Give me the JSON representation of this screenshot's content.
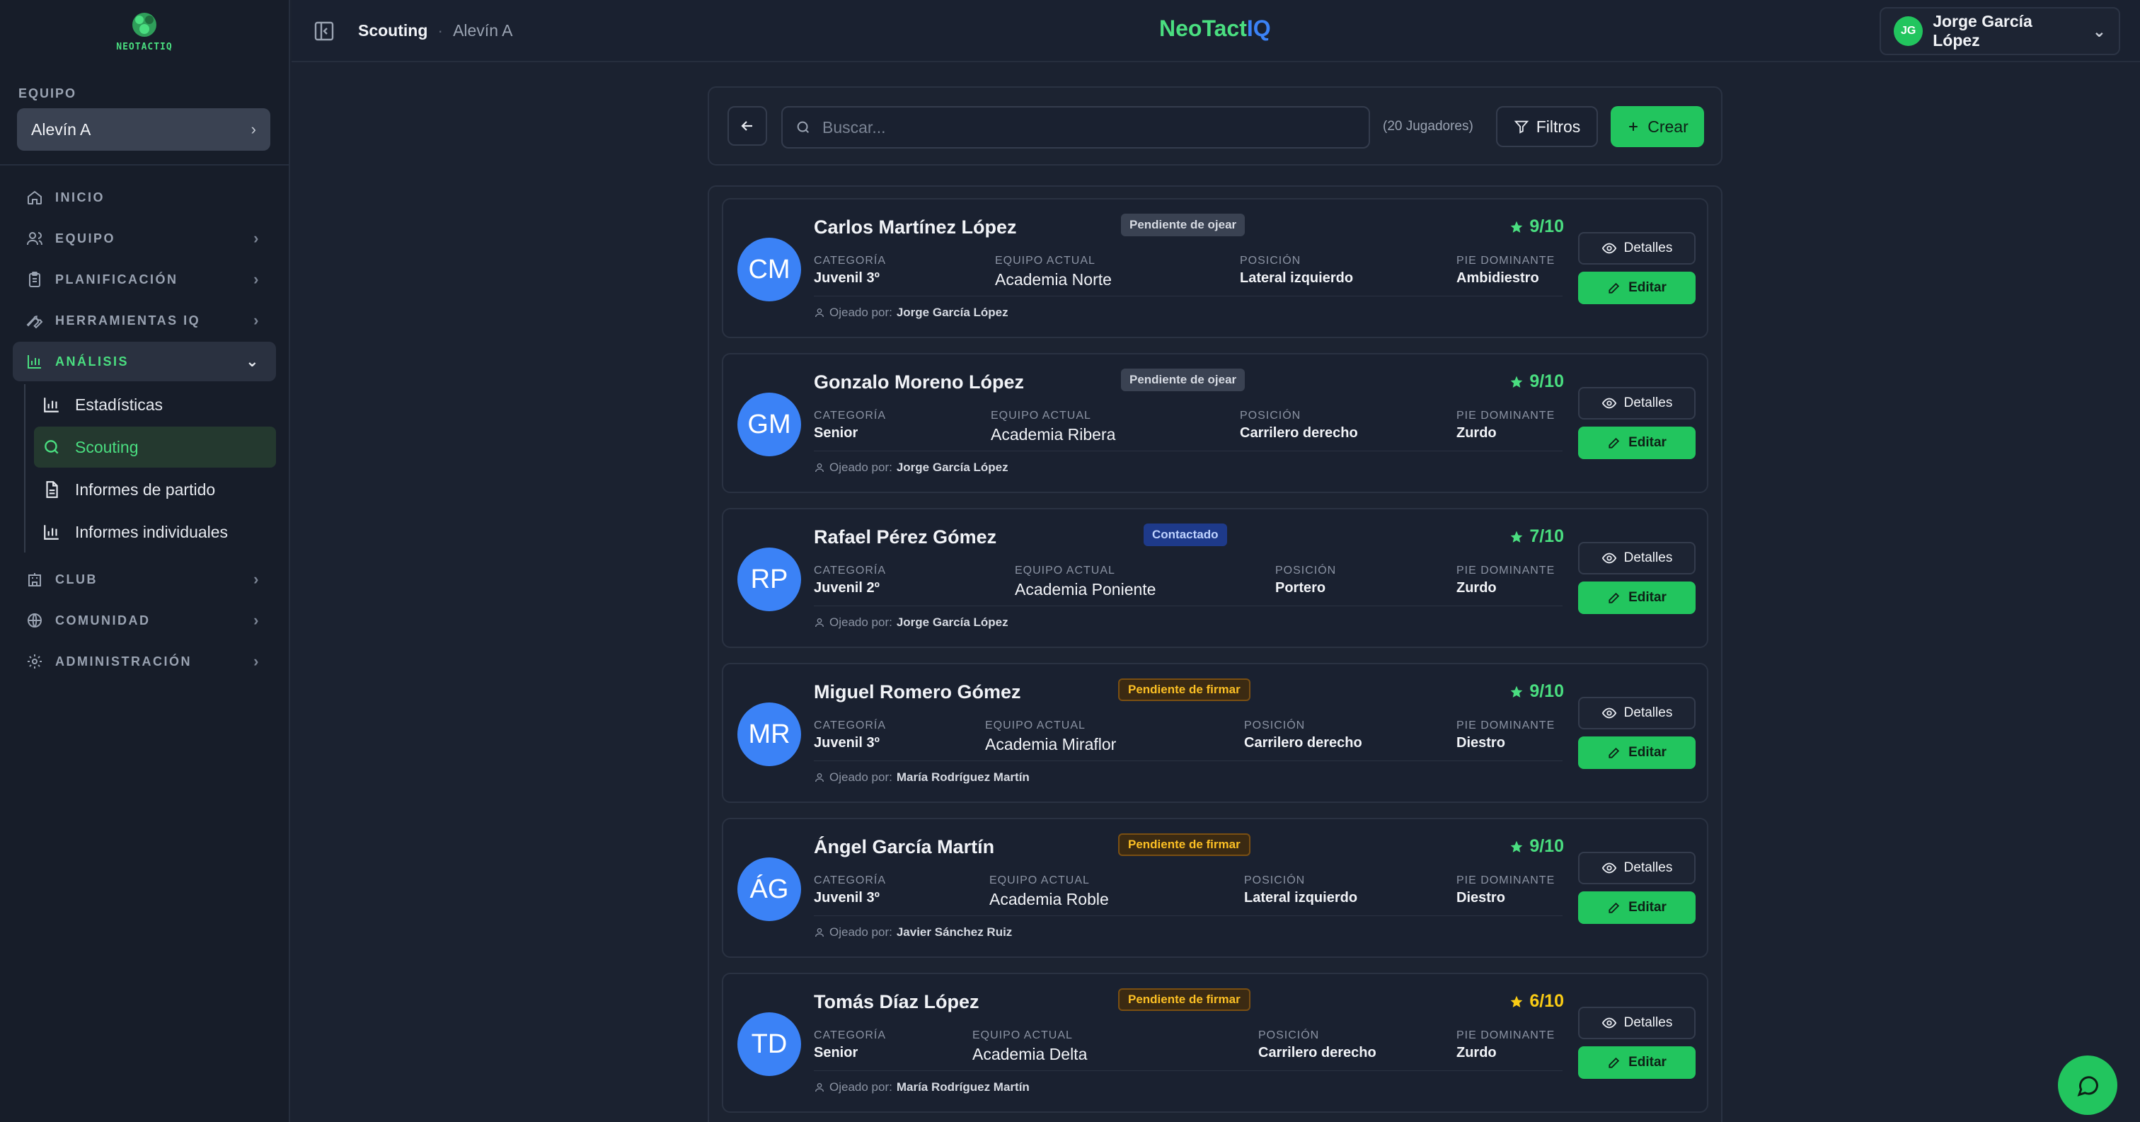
{
  "brand": {
    "logo_text": "NEOTACTIQ",
    "name_part1": "NeoTact",
    "name_part2": "IQ"
  },
  "sidebar": {
    "section_label": "EQUIPO",
    "team_select": "Alevín A",
    "nav": [
      {
        "label": "INICIO",
        "icon": "home-icon"
      },
      {
        "label": "EQUIPO",
        "icon": "users-icon"
      },
      {
        "label": "PLANIFICACIÓN",
        "icon": "clipboard-icon"
      },
      {
        "label": "HERRAMIENTAS IQ",
        "icon": "wrench-icon"
      },
      {
        "label": "ANÁLISIS",
        "icon": "chart-icon"
      },
      {
        "label": "CLUB",
        "icon": "building-icon"
      },
      {
        "label": "COMUNIDAD",
        "icon": "globe-icon"
      },
      {
        "label": "ADMINISTRACIÓN",
        "icon": "gear-icon"
      }
    ],
    "sub": [
      {
        "label": "Estadísticas"
      },
      {
        "label": "Scouting"
      },
      {
        "label": "Informes de partido"
      },
      {
        "label": "Informes individuales"
      }
    ]
  },
  "header": {
    "crumb_1": "Scouting",
    "crumb_sep": "·",
    "crumb_2": "Alevín A",
    "user_initials": "JG",
    "user_name": "Jorge García López"
  },
  "toolbar": {
    "search_placeholder": "Buscar...",
    "count": "(20 Jugadores)",
    "filters": "Filtros",
    "create": "Crear"
  },
  "labels": {
    "category": "CATEGORÍA",
    "team": "EQUIPO ACTUAL",
    "position": "POSICIÓN",
    "foot": "PIE DOMINANTE",
    "scouted_by": "Ojeado por:",
    "details": "Detalles",
    "edit": "Editar"
  },
  "players": [
    {
      "initials": "CM",
      "name": "Carlos Martínez López",
      "status": "Pendiente de ojear",
      "rating": "9/10",
      "category": "Juvenil 3º",
      "team": "Academia Norte",
      "position": "Lateral izquierdo",
      "foot": "Ambidiestro",
      "scout": "Jorge García López"
    },
    {
      "initials": "GM",
      "name": "Gonzalo Moreno López",
      "status": "Pendiente de ojear",
      "rating": "9/10",
      "category": "Senior",
      "team": "Academia Ribera",
      "position": "Carrilero derecho",
      "foot": "Zurdo",
      "scout": "Jorge García López"
    },
    {
      "initials": "RP",
      "name": "Rafael Pérez Gómez",
      "status": "Contactado",
      "rating": "7/10",
      "category": "Juvenil 2º",
      "team": "Academia Poniente",
      "position": "Portero",
      "foot": "Zurdo",
      "scout": "Jorge García López"
    },
    {
      "initials": "MR",
      "name": "Miguel Romero Gómez",
      "status": "Pendiente de firmar",
      "rating": "9/10",
      "category": "Juvenil 3º",
      "team": "Academia Miraflor",
      "position": "Carrilero derecho",
      "foot": "Diestro",
      "scout": "María Rodríguez Martín"
    },
    {
      "initials": "ÁG",
      "name": "Ángel García Martín",
      "status": "Pendiente de firmar",
      "rating": "9/10",
      "category": "Juvenil 3º",
      "team": "Academia Roble",
      "position": "Lateral izquierdo",
      "foot": "Diestro",
      "scout": "Javier Sánchez Ruiz"
    },
    {
      "initials": "TD",
      "name": "Tomás Díaz López",
      "status": "Pendiente de firmar",
      "rating": "6/10",
      "category": "Senior",
      "team": "Academia Delta",
      "position": "Carrilero derecho",
      "foot": "Zurdo",
      "scout": "María Rodríguez Martín"
    }
  ],
  "colors": {
    "accent": "#22c55e",
    "brand_blue": "#3b82f6",
    "bg": "#1b2230"
  }
}
